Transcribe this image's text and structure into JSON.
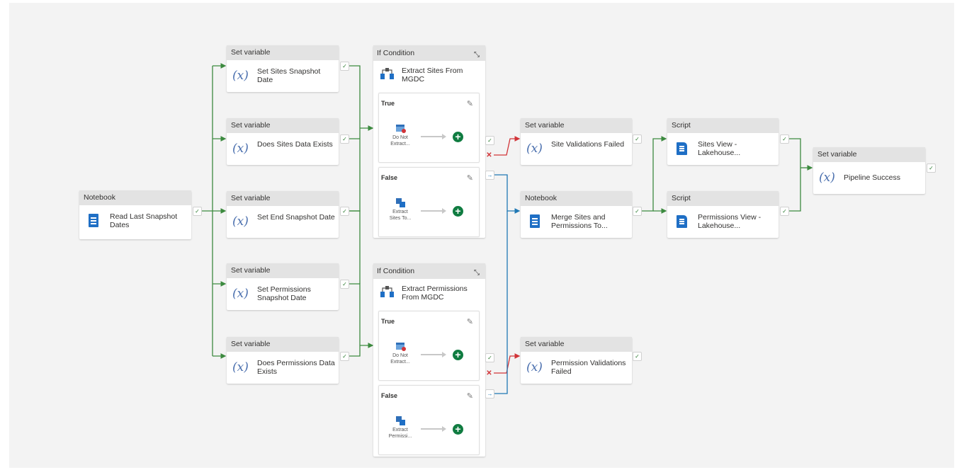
{
  "pipeline": {
    "notebook_read": {
      "header": "Notebook",
      "name": "Read Last Snapshot Dates"
    },
    "setvars": [
      {
        "header": "Set variable",
        "name": "Set Sites Snapshot Date"
      },
      {
        "header": "Set variable",
        "name": "Does Sites Data Exists"
      },
      {
        "header": "Set variable",
        "name": "Set End Snapshot Date"
      },
      {
        "header": "Set variable",
        "name": "Set Permissions Snapshot Date"
      },
      {
        "header": "Set variable",
        "name": "Does Permissions Data Exists"
      }
    ],
    "if_sites": {
      "header": "If Condition",
      "title": "Extract Sites From MGDC",
      "true_label": "True",
      "true_activity": "Do Not Extract...",
      "false_label": "False",
      "false_activity": "Extract Sites To..."
    },
    "if_perms": {
      "header": "If Condition",
      "title": "Extract Permissions From MGDC",
      "true_label": "True",
      "true_activity": "Do Not Extract...",
      "false_label": "False",
      "false_activity": "Extract Permissi..."
    },
    "site_validation": {
      "header": "Set variable",
      "name": "Site Validations Failed"
    },
    "merge_notebook": {
      "header": "Notebook",
      "name": "Merge Sites and Permissions To..."
    },
    "perm_validation": {
      "header": "Set variable",
      "name": "Permission Validations Failed"
    },
    "script_sites": {
      "header": "Script",
      "name": "Sites View - Lakehouse..."
    },
    "script_perms": {
      "header": "Script",
      "name": "Permissions View - Lakehouse..."
    },
    "pipeline_success": {
      "header": "Set variable",
      "name": "Pipeline Success"
    }
  },
  "colors": {
    "success": "#2e7d32",
    "failure": "#d13438",
    "completion": "#1f78b4",
    "activity_header": "#e3e3e3",
    "canvas": "#f3f3f3"
  },
  "icons": {
    "set_variable": "variable-x-icon",
    "notebook": "notebook-icon",
    "script": "script-icon",
    "if_condition": "if-condition-icon",
    "success_port": "checkmark-icon",
    "fail_port": "x-icon",
    "completion_port": "arrow-right-icon",
    "edit": "pencil-icon",
    "add": "plus-icon"
  }
}
